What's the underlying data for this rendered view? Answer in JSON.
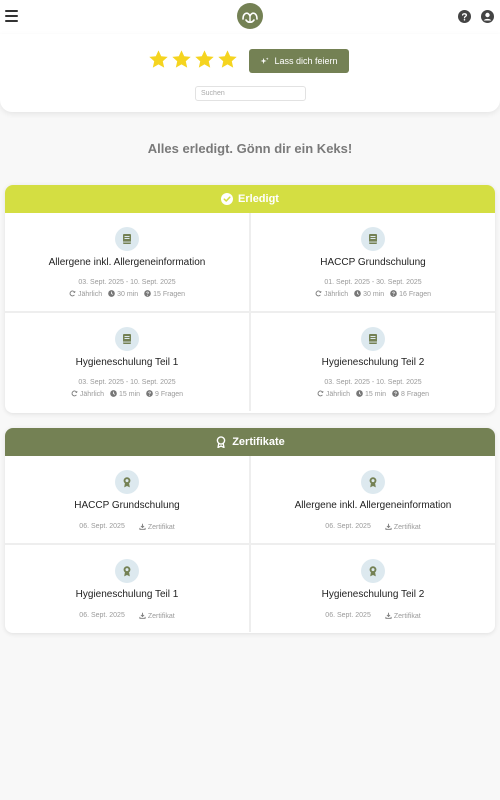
{
  "header": {
    "menu_icon": "hamburger-icon",
    "logo_icon": "leaf-logo-icon",
    "help_icon": "help-circle-icon",
    "account_icon": "account-circle-icon"
  },
  "rating": {
    "value": 4,
    "max": 4,
    "color": "#f5d41f"
  },
  "celebrate_button": {
    "label": "Lass dich feiern",
    "icon": "sparkle-icon"
  },
  "search": {
    "placeholder": "Suchen",
    "value": ""
  },
  "headline": "Alles erledigt. Gönn dir ein Keks!",
  "colors": {
    "accent": "#748154",
    "done_header": "#d4de42",
    "icon_bg": "#dde9ef"
  },
  "done_section": {
    "title": "Erledigt",
    "icon": "check-circle-icon",
    "items": [
      {
        "title": "Allergene inkl. Allergeneinformation",
        "dates": "03. Sept. 2025 - 10. Sept. 2025",
        "repeat": "Jährlich",
        "duration": "30 min",
        "questions": "15 Fragen",
        "icon": "book-icon"
      },
      {
        "title": "HACCP Grundschulung",
        "dates": "01. Sept. 2025 - 30. Sept. 2025",
        "repeat": "Jährlich",
        "duration": "30 min",
        "questions": "16 Fragen",
        "icon": "book-icon"
      },
      {
        "title": "Hygieneschulung Teil 1",
        "dates": "03. Sept. 2025 - 10. Sept. 2025",
        "repeat": "Jährlich",
        "duration": "15 min",
        "questions": "9 Fragen",
        "icon": "book-icon"
      },
      {
        "title": "Hygieneschulung Teil 2",
        "dates": "03. Sept. 2025 - 10. Sept. 2025",
        "repeat": "Jährlich",
        "duration": "15 min",
        "questions": "8 Fragen",
        "icon": "book-icon"
      }
    ]
  },
  "cert_section": {
    "title": "Zertifikate",
    "icon": "award-icon",
    "items": [
      {
        "title": "HACCP Grundschulung",
        "date": "06. Sept. 2025",
        "download": "Zertifikat",
        "icon": "award-icon"
      },
      {
        "title": "Allergene inkl. Allergeneinformation",
        "date": "06. Sept. 2025",
        "download": "Zertifikat",
        "icon": "award-icon"
      },
      {
        "title": "Hygieneschulung Teil 1",
        "date": "06. Sept. 2025",
        "download": "Zertifikat",
        "icon": "award-icon"
      },
      {
        "title": "Hygieneschulung Teil 2",
        "date": "06. Sept. 2025",
        "download": "Zertifikat",
        "icon": "award-icon"
      }
    ]
  }
}
